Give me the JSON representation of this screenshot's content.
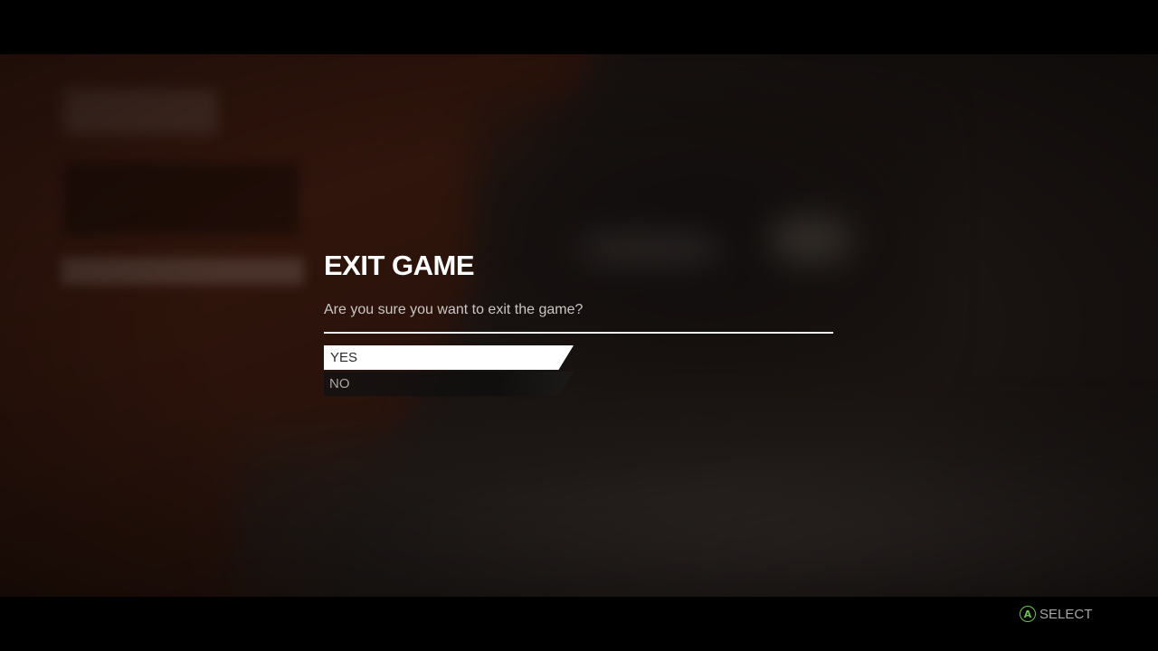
{
  "dialog": {
    "title": "EXIT GAME",
    "message": "Are you sure you want to exit the game?",
    "options": [
      {
        "label": "YES",
        "selected": true
      },
      {
        "label": "NO",
        "selected": false
      }
    ]
  },
  "footer": {
    "button_glyph": "A",
    "button_icon": "controller-a-button-icon",
    "action_label": "SELECT"
  },
  "colors": {
    "button_a": "#6cc24a",
    "selected_bg": "#ffffff",
    "title": "#ffffff"
  }
}
